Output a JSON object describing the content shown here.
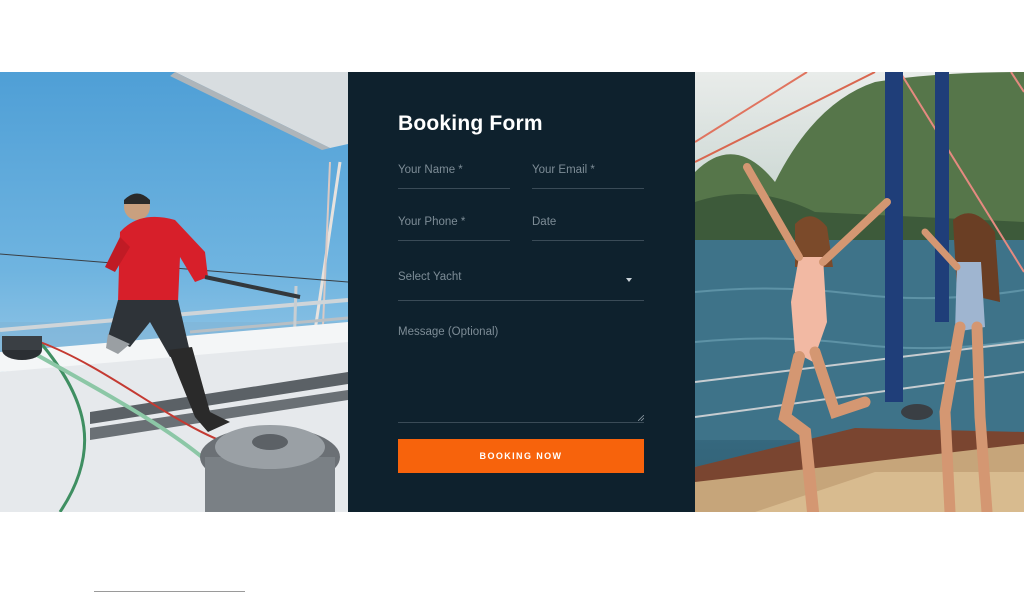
{
  "booking_form": {
    "title": "Booking Form",
    "name_placeholder": "Your Name *",
    "email_placeholder": "Your Email  *",
    "phone_placeholder": "Your Phone *",
    "date_placeholder": "Date",
    "yacht_select": "Select Yacht",
    "message_placeholder": "Message (Optional)",
    "submit_label": "BOOKING NOW"
  },
  "colors": {
    "panel_background": "#0e212d",
    "accent": "#f7630c",
    "field_label": "#7d8c96",
    "field_line": "#3a4b57"
  },
  "images": {
    "left": "sailor-on-sailboat-photo",
    "right": "women-on-yacht-deck-photo"
  }
}
